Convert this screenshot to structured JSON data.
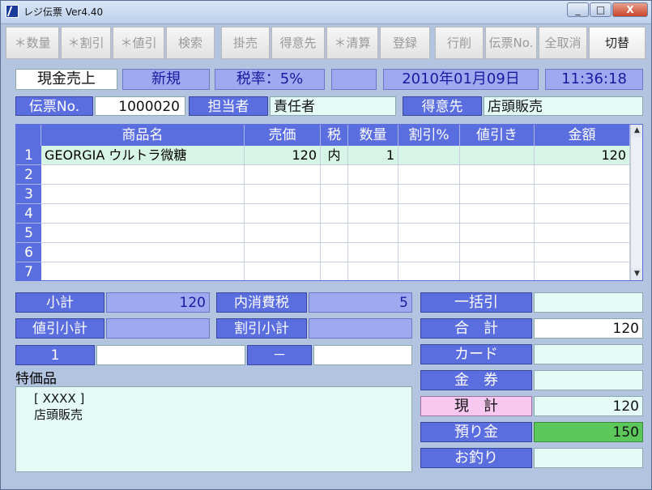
{
  "window": {
    "title": "レジ伝票  Ver4.40",
    "min": "_",
    "max": "□",
    "close": "X"
  },
  "toolbar": [
    {
      "label": "＊数量",
      "enabled": false
    },
    {
      "label": "＊割引",
      "enabled": false
    },
    {
      "label": "＊値引",
      "enabled": false
    },
    {
      "label": "検索",
      "enabled": false
    },
    {
      "label": "掛売",
      "enabled": false
    },
    {
      "label": "得意先",
      "enabled": false
    },
    {
      "label": "＊清算",
      "enabled": false
    },
    {
      "label": "登録",
      "enabled": false
    },
    {
      "label": "行削",
      "enabled": false
    },
    {
      "label": "伝票No.",
      "enabled": false
    },
    {
      "label": "全取消",
      "enabled": false
    },
    {
      "label": "切替",
      "enabled": true
    }
  ],
  "status": {
    "mode": "現金売上",
    "state": "新規",
    "tax": "税率：5%",
    "blank": "",
    "date": "2010年01月09日",
    "time": "11:36:18"
  },
  "info": {
    "slip_label": "伝票No.",
    "slip_no": "1000020",
    "staff_label": "担当者",
    "staff": "責任者",
    "customer_label": "得意先",
    "customer": "店頭販売"
  },
  "grid": {
    "headers": [
      "",
      "商品名",
      "売価",
      "税",
      "数量",
      "割引%",
      "値引き",
      "金額"
    ],
    "rows": [
      {
        "no": "1",
        "name": "GEORGIA ウルトラ微糖",
        "price": "120",
        "tax": "内",
        "qty": "1",
        "disc_pct": "",
        "disc": "",
        "amount": "120"
      },
      {
        "no": "2",
        "name": "",
        "price": "",
        "tax": "",
        "qty": "",
        "disc_pct": "",
        "disc": "",
        "amount": ""
      },
      {
        "no": "3",
        "name": "",
        "price": "",
        "tax": "",
        "qty": "",
        "disc_pct": "",
        "disc": "",
        "amount": ""
      },
      {
        "no": "4",
        "name": "",
        "price": "",
        "tax": "",
        "qty": "",
        "disc_pct": "",
        "disc": "",
        "amount": ""
      },
      {
        "no": "5",
        "name": "",
        "price": "",
        "tax": "",
        "qty": "",
        "disc_pct": "",
        "disc": "",
        "amount": ""
      },
      {
        "no": "6",
        "name": "",
        "price": "",
        "tax": "",
        "qty": "",
        "disc_pct": "",
        "disc": "",
        "amount": ""
      },
      {
        "no": "7",
        "name": "",
        "price": "",
        "tax": "",
        "qty": "",
        "disc_pct": "",
        "disc": "",
        "amount": ""
      }
    ]
  },
  "summary": {
    "subtotal_label": "小計",
    "subtotal": "120",
    "intax_label": "内消費税",
    "intax": "5",
    "disc_sub_label": "値引小計",
    "disc_sub": "",
    "pct_sub_label": "割引小計",
    "pct_sub": "",
    "page": "1",
    "page_val": "",
    "dash": "－",
    "dash_val": ""
  },
  "special": {
    "label": "特価品",
    "lines": [
      "[ XXXX ]",
      "店頭販売"
    ]
  },
  "totals": {
    "bulk_label": "一括引",
    "bulk": "",
    "total_label": "合　計",
    "total": "120",
    "card_label": "カード",
    "card": "",
    "voucher_label": "金　券",
    "voucher": "",
    "cash_label": "現　計",
    "cash": "120",
    "deposit_label": "預り金",
    "deposit": "150",
    "change_label": "お釣り",
    "change": ""
  },
  "colors": {
    "label_blue": "#5a6ee0",
    "light_label": "#9eaaf0",
    "value_bg": "#e4fbf8",
    "deposit_green": "#5cc85c",
    "cash_pink": "#f7c8f0"
  }
}
